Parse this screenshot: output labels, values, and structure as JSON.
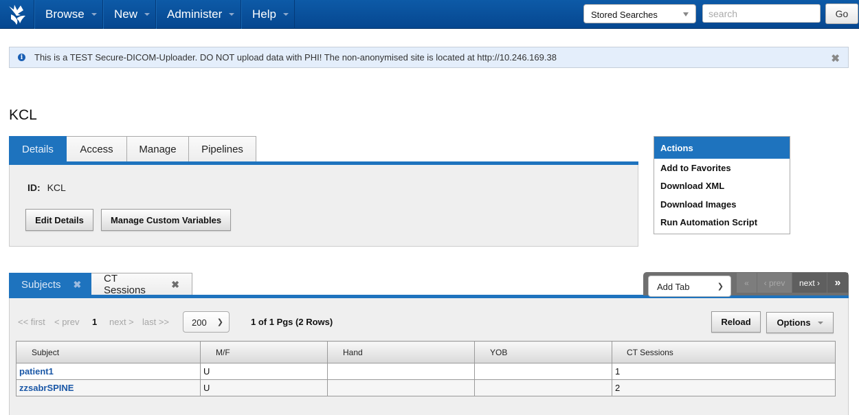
{
  "nav": {
    "items": [
      {
        "label": "Browse"
      },
      {
        "label": "New"
      },
      {
        "label": "Administer"
      },
      {
        "label": "Help"
      }
    ],
    "stored_searches": "Stored Searches",
    "search_placeholder": "search",
    "go_label": "Go"
  },
  "banner": {
    "text": "This is a TEST Secure-DICOM-Uploader. DO NOT upload data with PHI! The non-anonymised site is located at http://10.246.169.38"
  },
  "project": {
    "title": "KCL",
    "tabs": [
      {
        "label": "Details",
        "active": true
      },
      {
        "label": "Access"
      },
      {
        "label": "Manage"
      },
      {
        "label": "Pipelines"
      }
    ],
    "id_label": "ID:",
    "id_value": "KCL",
    "edit_details": "Edit Details",
    "manage_custom_variables": "Manage Custom Variables"
  },
  "actions": {
    "title": "Actions",
    "items": [
      {
        "label": "Add to Favorites"
      },
      {
        "label": "Download XML"
      },
      {
        "label": "Download Images"
      },
      {
        "label": "Run Automation Script"
      }
    ]
  },
  "data_tabs": {
    "tabs": [
      {
        "label": "Subjects",
        "active": true
      },
      {
        "label": "CT Sessions"
      }
    ],
    "add_tab": "Add Tab",
    "tab_pager": {
      "first": "«",
      "prev": "‹ prev",
      "next": "next ›",
      "last": "»"
    }
  },
  "listing": {
    "pager": {
      "first": "<< first",
      "prev": "< prev",
      "current": "1",
      "next": "next >",
      "last": "last >>",
      "per_page": "200",
      "info": "1 of 1 Pgs (2 Rows)"
    },
    "reload": "Reload",
    "options": "Options",
    "columns": [
      "Subject",
      "M/F",
      "Hand",
      "YOB",
      "CT Sessions"
    ],
    "rows": [
      {
        "subject": "patient1",
        "mf": "U",
        "hand": "",
        "yob": "",
        "ct_sessions": "1"
      },
      {
        "subject": "zzsabrSPINE",
        "mf": "U",
        "hand": "",
        "yob": "",
        "ct_sessions": "2"
      }
    ]
  }
}
